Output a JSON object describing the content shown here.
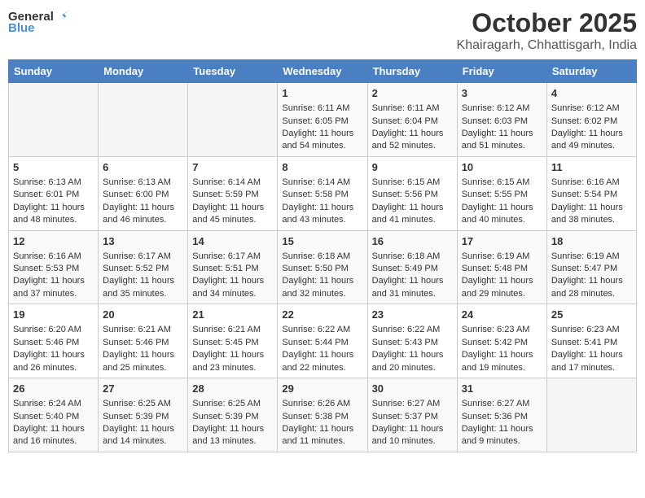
{
  "header": {
    "logo_general": "General",
    "logo_blue": "Blue",
    "month": "October 2025",
    "location": "Khairagarh, Chhattisgarh, India"
  },
  "weekdays": [
    "Sunday",
    "Monday",
    "Tuesday",
    "Wednesday",
    "Thursday",
    "Friday",
    "Saturday"
  ],
  "weeks": [
    [
      {
        "day": "",
        "info": ""
      },
      {
        "day": "",
        "info": ""
      },
      {
        "day": "",
        "info": ""
      },
      {
        "day": "1",
        "sunrise": "6:11 AM",
        "sunset": "6:05 PM",
        "daylight": "11 hours and 54 minutes."
      },
      {
        "day": "2",
        "sunrise": "6:11 AM",
        "sunset": "6:04 PM",
        "daylight": "11 hours and 52 minutes."
      },
      {
        "day": "3",
        "sunrise": "6:12 AM",
        "sunset": "6:03 PM",
        "daylight": "11 hours and 51 minutes."
      },
      {
        "day": "4",
        "sunrise": "6:12 AM",
        "sunset": "6:02 PM",
        "daylight": "11 hours and 49 minutes."
      }
    ],
    [
      {
        "day": "5",
        "sunrise": "6:13 AM",
        "sunset": "6:01 PM",
        "daylight": "11 hours and 48 minutes."
      },
      {
        "day": "6",
        "sunrise": "6:13 AM",
        "sunset": "6:00 PM",
        "daylight": "11 hours and 46 minutes."
      },
      {
        "day": "7",
        "sunrise": "6:14 AM",
        "sunset": "5:59 PM",
        "daylight": "11 hours and 45 minutes."
      },
      {
        "day": "8",
        "sunrise": "6:14 AM",
        "sunset": "5:58 PM",
        "daylight": "11 hours and 43 minutes."
      },
      {
        "day": "9",
        "sunrise": "6:15 AM",
        "sunset": "5:56 PM",
        "daylight": "11 hours and 41 minutes."
      },
      {
        "day": "10",
        "sunrise": "6:15 AM",
        "sunset": "5:55 PM",
        "daylight": "11 hours and 40 minutes."
      },
      {
        "day": "11",
        "sunrise": "6:16 AM",
        "sunset": "5:54 PM",
        "daylight": "11 hours and 38 minutes."
      }
    ],
    [
      {
        "day": "12",
        "sunrise": "6:16 AM",
        "sunset": "5:53 PM",
        "daylight": "11 hours and 37 minutes."
      },
      {
        "day": "13",
        "sunrise": "6:17 AM",
        "sunset": "5:52 PM",
        "daylight": "11 hours and 35 minutes."
      },
      {
        "day": "14",
        "sunrise": "6:17 AM",
        "sunset": "5:51 PM",
        "daylight": "11 hours and 34 minutes."
      },
      {
        "day": "15",
        "sunrise": "6:18 AM",
        "sunset": "5:50 PM",
        "daylight": "11 hours and 32 minutes."
      },
      {
        "day": "16",
        "sunrise": "6:18 AM",
        "sunset": "5:49 PM",
        "daylight": "11 hours and 31 minutes."
      },
      {
        "day": "17",
        "sunrise": "6:19 AM",
        "sunset": "5:48 PM",
        "daylight": "11 hours and 29 minutes."
      },
      {
        "day": "18",
        "sunrise": "6:19 AM",
        "sunset": "5:47 PM",
        "daylight": "11 hours and 28 minutes."
      }
    ],
    [
      {
        "day": "19",
        "sunrise": "6:20 AM",
        "sunset": "5:46 PM",
        "daylight": "11 hours and 26 minutes."
      },
      {
        "day": "20",
        "sunrise": "6:21 AM",
        "sunset": "5:46 PM",
        "daylight": "11 hours and 25 minutes."
      },
      {
        "day": "21",
        "sunrise": "6:21 AM",
        "sunset": "5:45 PM",
        "daylight": "11 hours and 23 minutes."
      },
      {
        "day": "22",
        "sunrise": "6:22 AM",
        "sunset": "5:44 PM",
        "daylight": "11 hours and 22 minutes."
      },
      {
        "day": "23",
        "sunrise": "6:22 AM",
        "sunset": "5:43 PM",
        "daylight": "11 hours and 20 minutes."
      },
      {
        "day": "24",
        "sunrise": "6:23 AM",
        "sunset": "5:42 PM",
        "daylight": "11 hours and 19 minutes."
      },
      {
        "day": "25",
        "sunrise": "6:23 AM",
        "sunset": "5:41 PM",
        "daylight": "11 hours and 17 minutes."
      }
    ],
    [
      {
        "day": "26",
        "sunrise": "6:24 AM",
        "sunset": "5:40 PM",
        "daylight": "11 hours and 16 minutes."
      },
      {
        "day": "27",
        "sunrise": "6:25 AM",
        "sunset": "5:39 PM",
        "daylight": "11 hours and 14 minutes."
      },
      {
        "day": "28",
        "sunrise": "6:25 AM",
        "sunset": "5:39 PM",
        "daylight": "11 hours and 13 minutes."
      },
      {
        "day": "29",
        "sunrise": "6:26 AM",
        "sunset": "5:38 PM",
        "daylight": "11 hours and 11 minutes."
      },
      {
        "day": "30",
        "sunrise": "6:27 AM",
        "sunset": "5:37 PM",
        "daylight": "11 hours and 10 minutes."
      },
      {
        "day": "31",
        "sunrise": "6:27 AM",
        "sunset": "5:36 PM",
        "daylight": "11 hours and 9 minutes."
      },
      {
        "day": "",
        "info": ""
      }
    ]
  ],
  "labels": {
    "sunrise_prefix": "Sunrise: ",
    "sunset_prefix": "Sunset: ",
    "daylight_label": "Daylight: "
  }
}
